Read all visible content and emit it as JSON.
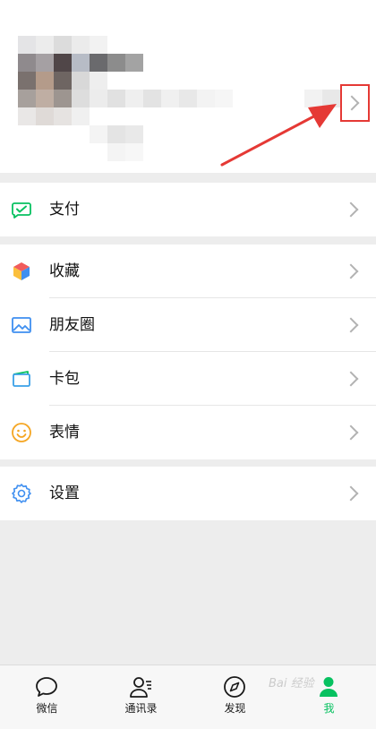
{
  "colors": {
    "accent": "#07c160",
    "annotation_red": "#e53935",
    "chevron": "#b2b2b2"
  },
  "profile": {
    "arrow_icon": "chevron-right-icon",
    "annotation": "red-arrow-pointing-to-chevron"
  },
  "menu": {
    "pay": {
      "label": "支付",
      "icon": "wallet-check-icon"
    },
    "favorites": {
      "label": "收藏",
      "icon": "cube-icon"
    },
    "moments": {
      "label": "朋友圈",
      "icon": "image-icon"
    },
    "cards": {
      "label": "卡包",
      "icon": "card-icon"
    },
    "stickers": {
      "label": "表情",
      "icon": "smiley-icon"
    },
    "settings": {
      "label": "设置",
      "icon": "gear-icon"
    }
  },
  "tabbar": {
    "chats": {
      "label": "微信",
      "icon": "chat-bubble-icon"
    },
    "contacts": {
      "label": "通讯录",
      "icon": "contacts-icon"
    },
    "discover": {
      "label": "发现",
      "icon": "compass-icon"
    },
    "me": {
      "label": "我",
      "icon": "person-icon"
    }
  },
  "watermark": "Bai 经验"
}
